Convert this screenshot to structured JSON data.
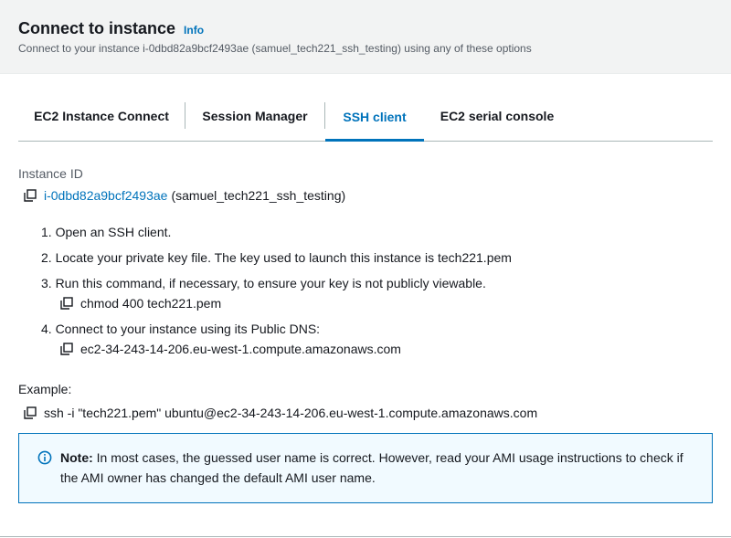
{
  "header": {
    "title": "Connect to instance",
    "info_label": "Info",
    "subtitle": "Connect to your instance i-0dbd82a9bcf2493ae (samuel_tech221_ssh_testing) using any of these options"
  },
  "tabs": [
    {
      "label": "EC2 Instance Connect",
      "active": false
    },
    {
      "label": "Session Manager",
      "active": false
    },
    {
      "label": "SSH client",
      "active": true
    },
    {
      "label": "EC2 serial console",
      "active": false
    }
  ],
  "instance": {
    "label": "Instance ID",
    "id": "i-0dbd82a9bcf2493ae",
    "name": "(samuel_tech221_ssh_testing)"
  },
  "steps": [
    {
      "text": "1. Open an SSH client."
    },
    {
      "text": "2. Locate your private key file. The key used to launch this instance is tech221.pem"
    },
    {
      "text": "3. Run this command, if necessary, to ensure your key is not publicly viewable.",
      "command": "chmod 400 tech221.pem"
    },
    {
      "text": "4. Connect to your instance using its Public DNS:",
      "command": "ec2-34-243-14-206.eu-west-1.compute.amazonaws.com"
    }
  ],
  "example": {
    "label": "Example:",
    "command": "ssh -i \"tech221.pem\" ubuntu@ec2-34-243-14-206.eu-west-1.compute.amazonaws.com"
  },
  "note": {
    "label": "Note:",
    "text": " In most cases, the guessed user name is correct. However, read your AMI usage instructions to check if the AMI owner has changed the default AMI user name."
  },
  "colors": {
    "link": "#0073bb",
    "header_bg": "#f2f3f3",
    "note_bg": "#f1faff",
    "note_border": "#0073bb"
  },
  "icons": {
    "copy": "copy-icon",
    "info": "info-circle-icon"
  }
}
